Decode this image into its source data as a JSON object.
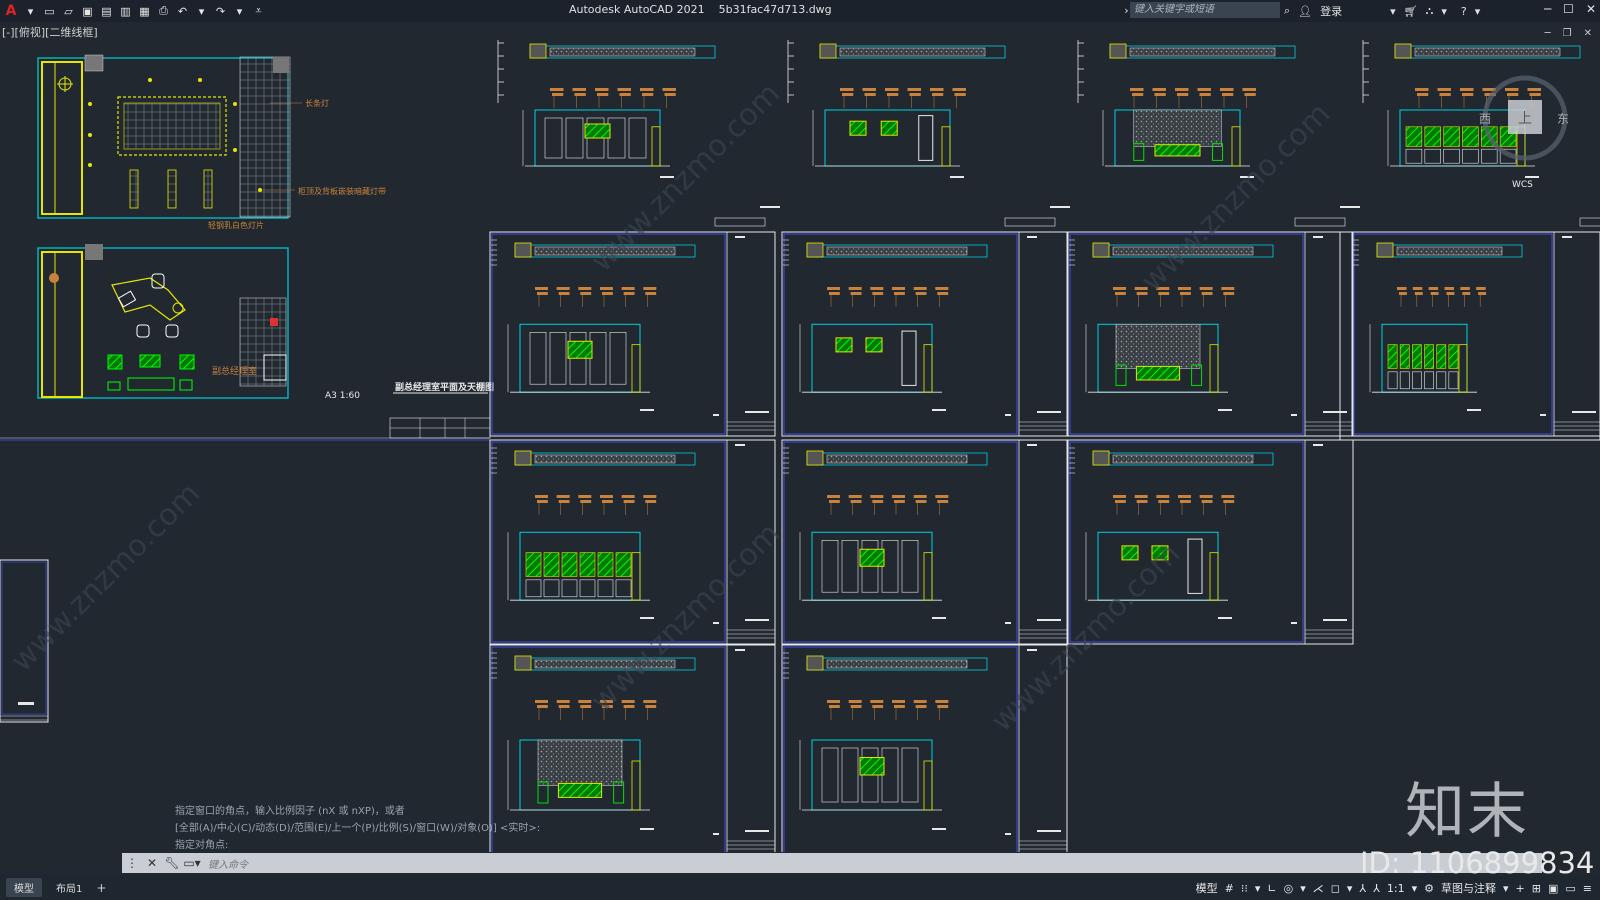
{
  "app": {
    "title": "Autodesk AutoCAD 2021",
    "filename": "5b31fac47d713.dwg",
    "search_placeholder": "键入关键字或短语",
    "login_label": "登录"
  },
  "viewport": {
    "label": "[-][俯视][二维线框]"
  },
  "viewcube": {
    "west": "西",
    "east": "东",
    "top": "上",
    "wcs": "WCS"
  },
  "plan": {
    "label_top": "长条灯",
    "label_mid": "柜顶及背板嵌装暗藏灯带",
    "label_ceiling": "轻钢乳白色灯片",
    "label_room": "副总经理室",
    "scale": "A3  1:60",
    "title": "副总经理室平面及天棚图"
  },
  "command": {
    "history": [
      "指定窗口的角点，输入比例因子 (nX 或 nXP)，或者",
      "[全部(A)/中心(C)/动态(D)/范围(E)/上一个(P)/比例(S)/窗口(W)/对象(O)] <实时>:",
      "指定对角点:"
    ],
    "placeholder": "键入命令"
  },
  "status": {
    "tabs": [
      "模型",
      "布局1"
    ],
    "model_label": "模型",
    "scale": "1:1",
    "workspace": "草图与注释"
  },
  "watermark": {
    "brand": "知末",
    "id": "ID: 1106899834",
    "diag": "www.znzmo.com"
  },
  "colors": {
    "bg": "#212830",
    "cyan": "#00d0e0",
    "yellow": "#e6e600",
    "green": "#00e000",
    "orange": "#c8823c",
    "white": "#e8e8e8",
    "frame": "#3a48c8"
  }
}
